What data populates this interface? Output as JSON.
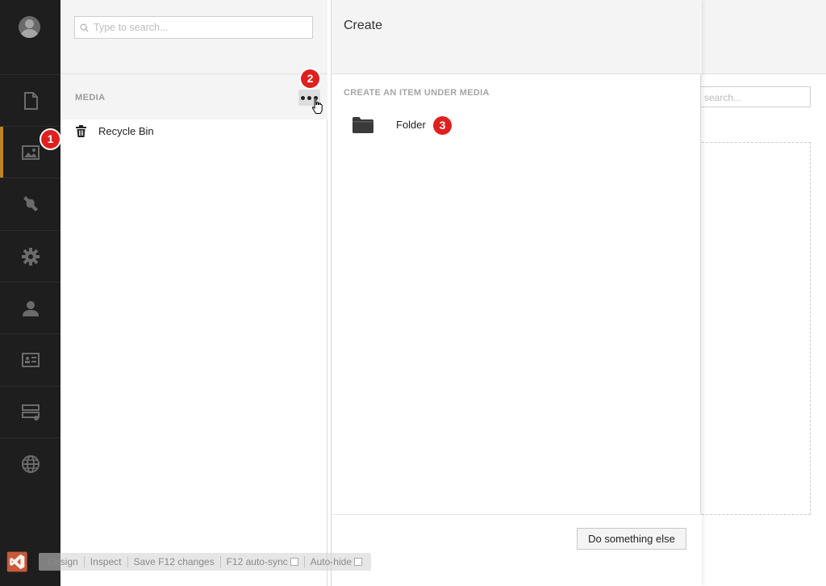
{
  "nav": {
    "items": [
      {
        "icon": "document-icon",
        "name": "content"
      },
      {
        "icon": "image-icon",
        "name": "media",
        "active": true
      },
      {
        "icon": "wrench-icon",
        "name": "settings-tools"
      },
      {
        "icon": "gear-icon",
        "name": "settings"
      },
      {
        "icon": "user-icon",
        "name": "users"
      },
      {
        "icon": "id-card-icon",
        "name": "members"
      },
      {
        "icon": "server-icon",
        "name": "forms"
      },
      {
        "icon": "globe-icon",
        "name": "translation"
      }
    ],
    "accent": "#f5a623"
  },
  "tree": {
    "search_placeholder": "Type to search...",
    "root_label": "MEDIA",
    "items": [
      {
        "label": "Recycle Bin",
        "icon": "trash-icon"
      }
    ]
  },
  "dialog": {
    "title": "Create",
    "subtitle": "CREATE AN ITEM UNDER MEDIA",
    "options": [
      {
        "label": "Folder",
        "icon": "folder-icon"
      }
    ],
    "footer_button": "Do something else"
  },
  "background_editor": {
    "search_placeholder": "search..."
  },
  "badges": [
    "1",
    "2",
    "3"
  ],
  "browser_link": {
    "items": [
      {
        "label": "Design",
        "checkbox": false
      },
      {
        "label": "Inspect",
        "checkbox": false
      },
      {
        "label": "Save F12 changes",
        "checkbox": false
      },
      {
        "label": "F12 auto-sync",
        "checkbox": true
      },
      {
        "label": "Auto-hide",
        "checkbox": true
      }
    ]
  },
  "colors": {
    "badge": "#e0201f",
    "nav_bg": "#1e1e1e",
    "panel_head_bg": "#f4f4f4"
  }
}
